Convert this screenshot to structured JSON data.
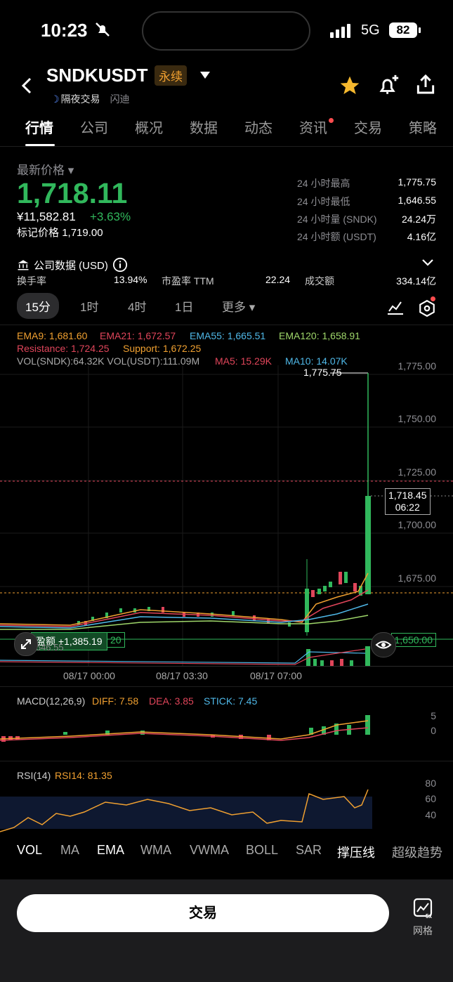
{
  "status": {
    "time": "10:23",
    "network": "5G",
    "battery": "82"
  },
  "header": {
    "symbol": "SNDKUSDT",
    "contract_type": "永续",
    "night_trade": "隔夜交易",
    "flash": "闪迪"
  },
  "tabs": [
    "行情",
    "公司",
    "概况",
    "数据",
    "动态",
    "资讯",
    "交易",
    "策略"
  ],
  "quote": {
    "label": "最新价格",
    "price": "1,718.11",
    "cny": "¥11,582.81",
    "change": "+3.63%",
    "mark_label": "标记价格",
    "mark": "1,719.00",
    "stats": [
      {
        "label": "24 小时最高",
        "value": "1,775.75"
      },
      {
        "label": "24 小时最低",
        "value": "1,646.55"
      },
      {
        "label": "24 小时量 (SNDK)",
        "value": "24.24万"
      },
      {
        "label": "24 小时额 (USDT)",
        "value": "4.16亿"
      }
    ]
  },
  "company": {
    "title": "公司数据 (USD)",
    "turnover_label": "换手率",
    "turnover": "13.94%",
    "pe_label": "市盈率 TTM",
    "pe": "22.24",
    "volume_label": "成交额",
    "volume": "334.14亿"
  },
  "timeframes": [
    "15分",
    "1时",
    "4时",
    "1日",
    "更多"
  ],
  "indicators": {
    "ema9": "EMA9: 1,681.60",
    "ema21": "EMA21: 1,672.57",
    "ema55": "EMA55: 1,665.51",
    "ema120": "EMA120: 1,658.91",
    "resistance": "Resistance: 1,724.25",
    "support": "Support: 1,672.25",
    "vol": "VOL(SNDK):64.32K VOL(USDT):111.09M",
    "ma5": "MA5: 15.29K",
    "ma10": "MA10: 14.07K"
  },
  "chart_axis": {
    "y_ticks": [
      "1,775.00",
      "1,750.00",
      "1,725.00",
      "1,700.00",
      "1,675.00",
      "1,650.00"
    ],
    "x_ticks": [
      "08/17 00:00",
      "08/17 03:30",
      "08/17 07:00"
    ],
    "high_label": "1,775.75",
    "current_price": "1,718.45",
    "countdown": "06:22",
    "pnl_label": "盈额 +1,385.19",
    "pnl_qty": "20",
    "left_value": "1,646.55"
  },
  "macd": {
    "label": "MACD(12,26,9)",
    "diff": "DIFF: 7.58",
    "dea": "DEA: 3.85",
    "stick": "STICK: 7.45",
    "ticks": [
      "5",
      "0"
    ]
  },
  "rsi": {
    "label": "RSI(14)",
    "rsi14": "RSI14: 81.35",
    "ticks": [
      "80",
      "60",
      "40"
    ]
  },
  "indicator_bar": [
    "VOL",
    "MA",
    "EMA",
    "WMA",
    "VWMA",
    "BOLL",
    "SAR",
    "撑压线",
    "超级趋势"
  ],
  "footer": {
    "trade": "交易",
    "grid": "网格"
  },
  "colors": {
    "up": "#31b85c",
    "down": "#e0455a",
    "accent": "#f0a030"
  }
}
